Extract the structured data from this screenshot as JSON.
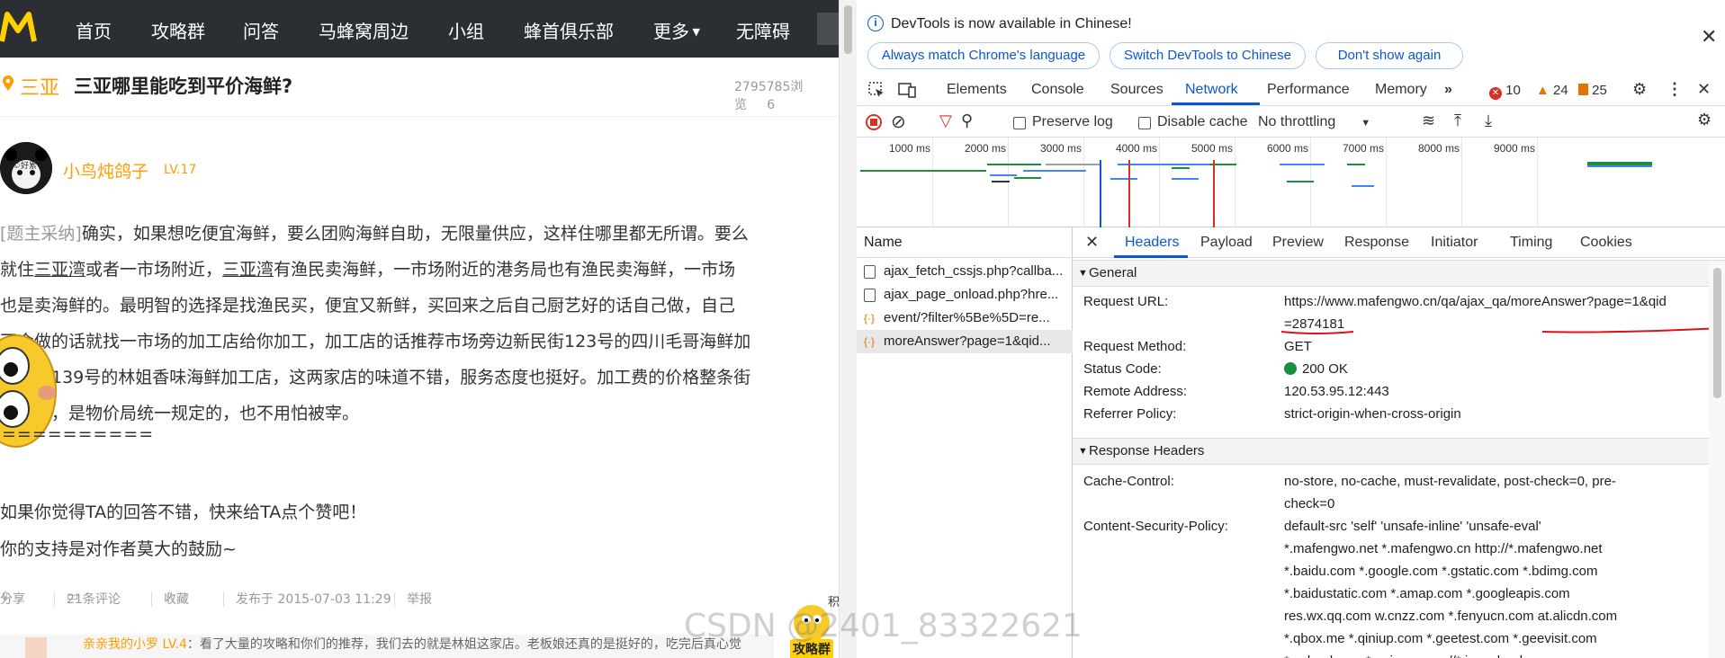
{
  "site": {
    "nav": [
      "首页",
      "攻略群",
      "问答",
      "马蜂窝周边",
      "小组",
      "蜂首俱乐部",
      "更多",
      "无障碍"
    ],
    "question": {
      "city": "三亚",
      "title": "三亚哪里能吃到平价海鲜?",
      "views": "2795785浏览",
      "views_tail": "6"
    },
    "answer": {
      "user": "小鸟炖鸽子",
      "level": "LV.17",
      "avatar_text": "©好累",
      "tag": "[题主采纳]",
      "lines": [
        "确实，如果想吃便宜海鲜，要么团购海鲜自助，无限量供应，这样住哪里都无所谓。要么",
        "就住|三亚湾|或者一市场附近，|三亚湾|有渔民卖海鲜，一市场附近的港务局也有渔民卖海鲜，一市场",
        "也是卖海鲜的。最明智的选择是找渔民买，便宜又新鲜，买回来之后自己厨艺好的话自己做，自己",
        "不会做的话就找一市场的加工店给你加工，加工店的话推荐市场旁边新民街123号的四川毛哥海鲜加",
        "工店，139号的林姐香味海鲜加工店，这两家店的味道不错，服务态度也挺好。加工费的价格整条街",
        "都一样，是物价局统一规定的，也不用怕被宰。"
      ],
      "separator": "==========",
      "like1": "如果你觉得TA的回答不错，快来给TA点个赞吧！",
      "like2": "你的支持是对作者莫大的鼓励~",
      "meta": {
        "share": "分享",
        "comments": "21条评论",
        "fav": "收藏",
        "date": "发布于 2015-07-03 11:29",
        "report": "举报"
      }
    },
    "comment": {
      "user": "亲亲我的小罗",
      "level": "LV.4",
      "text": "：看了大量的攻略和你们的推荐，我们去的就是林姐这家店。老板娘还真的是挺好的，吃完后真心觉"
    },
    "side": {
      "top": "积",
      "bottom": "攻略群"
    }
  },
  "devtools": {
    "banner": {
      "text": "DevTools is now available in Chinese!",
      "btn1": "Always match Chrome's language",
      "btn2": "Switch DevTools to Chinese",
      "btn3": "Don't show again"
    },
    "tabs": [
      "Elements",
      "Console",
      "Sources",
      "Network",
      "Performance",
      "Memory"
    ],
    "active_tab": "Network",
    "errors": "10",
    "warnings": "24",
    "issues": "25",
    "toolbar": {
      "preserve": "Preserve log",
      "disable": "Disable cache",
      "throttle": "No throttling"
    },
    "timeline_ticks": [
      "1000 ms",
      "2000 ms",
      "3000 ms",
      "4000 ms",
      "5000 ms",
      "6000 ms",
      "7000 ms",
      "8000 ms",
      "9000 ms"
    ],
    "name_header": "Name",
    "requests": [
      "ajax_fetch_cssjs.php?callba...",
      "ajax_page_onload.php?hre...",
      "event/?filter%5Be%5D=re...",
      "moreAnswer?page=1&qid..."
    ],
    "detail_tabs": [
      "Headers",
      "Payload",
      "Preview",
      "Response",
      "Initiator",
      "Timing",
      "Cookies"
    ],
    "general": {
      "title": "General",
      "request_url_k": "Request URL:",
      "request_url_v1": "https://www.mafengwo.cn/qa/ajax_qa/moreAnswer?page=1&qid",
      "request_url_v2": "=2874181",
      "method_k": "Request Method:",
      "method_v": "GET",
      "status_k": "Status Code:",
      "status_v": "200 OK",
      "remote_k": "Remote Address:",
      "remote_v": "120.53.95.12:443",
      "referrer_k": "Referrer Policy:",
      "referrer_v": "strict-origin-when-cross-origin"
    },
    "response": {
      "title": "Response Headers",
      "cache_k": "Cache-Control:",
      "cache_v1": "no-store, no-cache, must-revalidate, post-check=0, pre-",
      "cache_v2": "check=0",
      "csp_k": "Content-Security-Policy:",
      "csp_lines": [
        "default-src 'self' 'unsafe-inline' 'unsafe-eval'",
        "*.mafengwo.net *.mafengwo.cn http://*.mafengwo.net",
        "*.baidu.com *.google.com *.gstatic.com *.bdimg.com",
        "*.baidustatic.com *.amap.com *.googleapis.com",
        "res.wx.qq.com w.cnzz.com *.fenyucn.com at.alicdn.com",
        "*.qbox.me *.qiniup.com *.geetest.com *.geevisit.com",
        "*.qcloud.com *.qpic.cn wss://*.im.qcloud.com"
      ]
    }
  },
  "watermark": "CSDN @2401_83322621",
  "colors": {
    "accent": "#ff9d00",
    "devtools_blue": "#0b57d0",
    "nav_bg": "#2b2f33"
  }
}
